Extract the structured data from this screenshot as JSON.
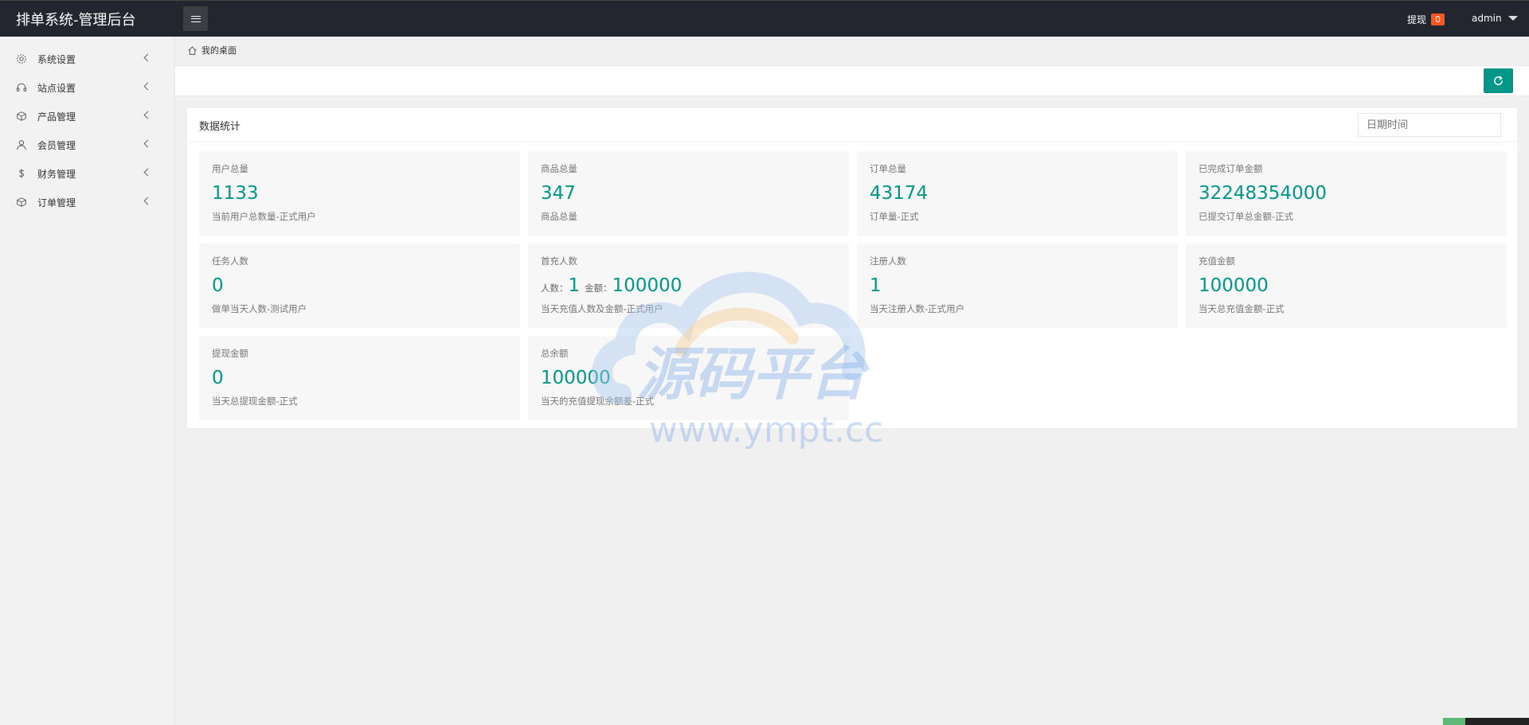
{
  "header": {
    "title": "排单系统-管理后台",
    "withdraw_label": "提现",
    "withdraw_badge": "0",
    "user_name": "admin"
  },
  "sidebar": {
    "items": [
      {
        "label": "系统设置",
        "icon": "gear-icon"
      },
      {
        "label": "站点设置",
        "icon": "headset-icon"
      },
      {
        "label": "产品管理",
        "icon": "box-icon"
      },
      {
        "label": "会员管理",
        "icon": "user-icon"
      },
      {
        "label": "财务管理",
        "icon": "dollar-icon"
      },
      {
        "label": "订单管理",
        "icon": "box-icon"
      }
    ]
  },
  "breadcrumb": {
    "label": "我的桌面",
    "icon": "home-icon"
  },
  "toolbar": {
    "refresh_icon": "refresh-icon",
    "accent": "#009688"
  },
  "stats": {
    "title": "数据统计",
    "date_placeholder": "日期时间",
    "cards": [
      {
        "title": "用户总量",
        "value": "1133",
        "desc": "当前用户总数量-正式用户"
      },
      {
        "title": "商品总量",
        "value": "347",
        "desc": "商品总量"
      },
      {
        "title": "订单总量",
        "value": "43174",
        "desc": "订单量-正式"
      },
      {
        "title": "已完成订单金额",
        "value": "32248354000",
        "desc": "已提交订单总金额-正式"
      },
      {
        "title": "任务人数",
        "value": "0",
        "desc": "做单当天人数-测试用户"
      },
      {
        "title": "首充人数",
        "people_label": "人数：",
        "people_value": "1",
        "amount_label": "金额：",
        "amount_value": "100000",
        "desc": "当天充值人数及金额-正式用户"
      },
      {
        "title": "注册人数",
        "value": "1",
        "desc": "当天注册人数-正式用户"
      },
      {
        "title": "充值金额",
        "value": "100000",
        "desc": "当天总充值金额-正式"
      },
      {
        "title": "提现金额",
        "value": "0",
        "desc": "当天总提现金额-正式"
      },
      {
        "title": "总余额",
        "value": "100000",
        "desc": "当天的充值提现余额差-正式"
      }
    ]
  },
  "watermark": {
    "title": "源码平台",
    "url": "www.ympt.cc"
  }
}
